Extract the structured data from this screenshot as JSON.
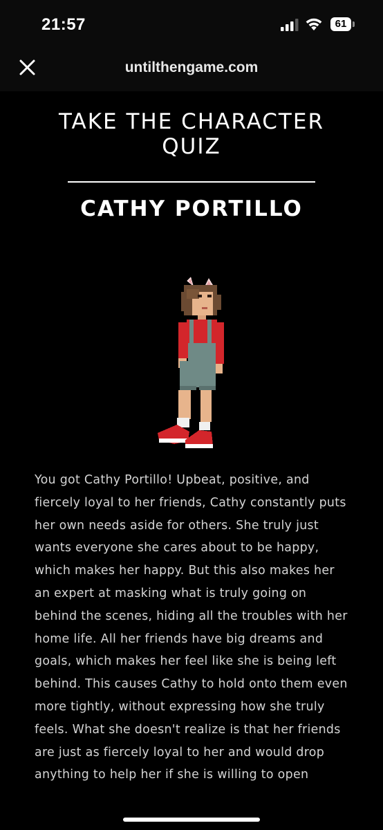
{
  "status_bar": {
    "time": "21:57",
    "battery_level": "61",
    "icons": [
      "signal-icon",
      "wifi-icon",
      "battery-icon"
    ]
  },
  "browser": {
    "url": "untilthengame.com",
    "close_icon": "close-icon"
  },
  "quiz": {
    "title": "TAKE THE CHARACTER QUIZ",
    "result_name": "CATHY PORTILLO",
    "description": "You got Cathy Portillo! Upbeat, positive, and fiercely loyal to her friends, Cathy constantly puts her own needs aside for others. She truly just wants everyone she cares about to be happy, which makes her happy. But this also makes her an expert at masking what is truly going on behind the scenes, hiding all the troubles with her home life. All her friends have big dreams and goals, which makes her feel like she is being left behind. This causes Cathy to hold onto them even more tightly, without expressing how she truly feels. What she doesn't realize is that her friends are just as fiercely loyal to her and would drop anything to help her if she is willing to open"
  },
  "colors": {
    "background": "#000000",
    "header_background": "#0b0b0b",
    "body_text": "#d4d4d4",
    "sprite_shirt": "#d3262b",
    "sprite_overalls": "#6f8a86"
  }
}
